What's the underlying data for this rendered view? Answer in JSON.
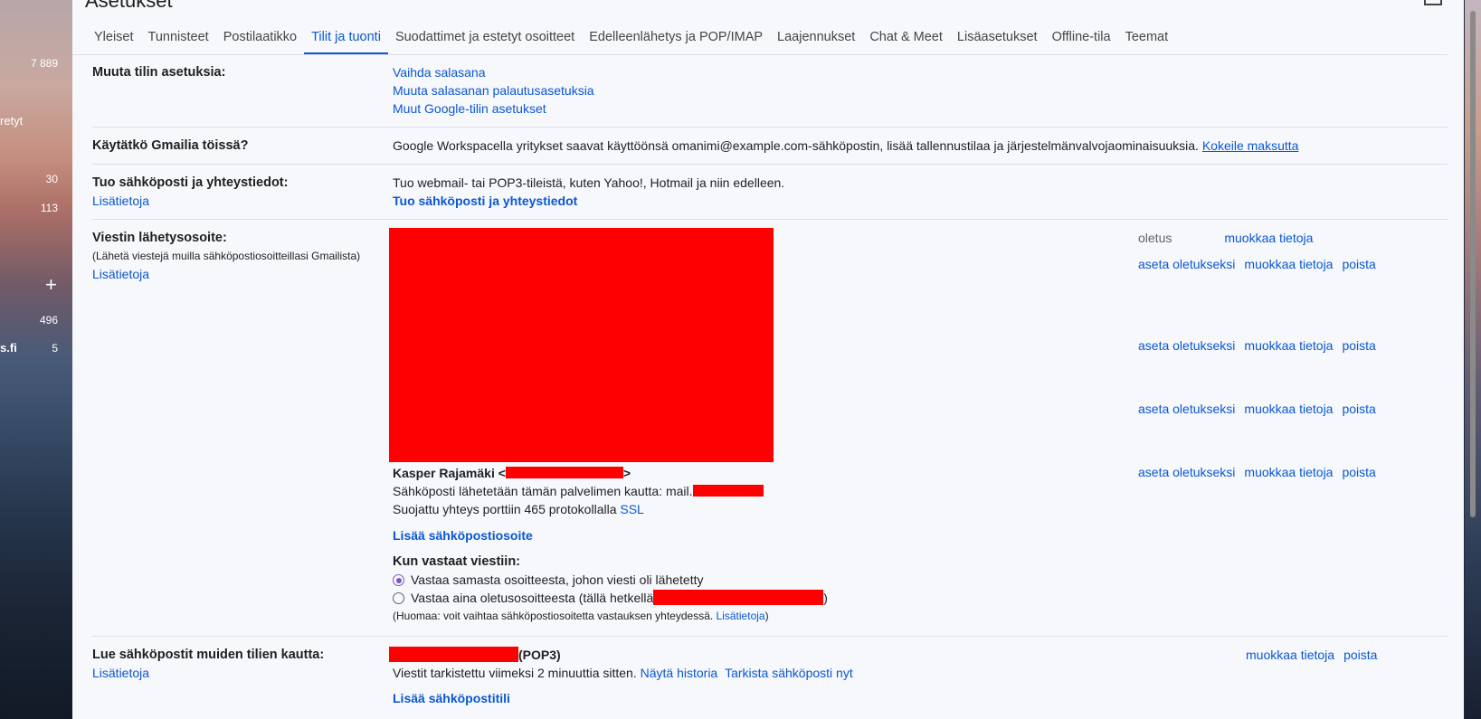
{
  "left_nav": {
    "count1": "7 889",
    "label1": "retyt",
    "count2": "30",
    "count3": "113",
    "plus": "+",
    "count4": "496",
    "label2": "s.fi",
    "count5": "5"
  },
  "page_title": "Asetukset",
  "tabs": [
    "Yleiset",
    "Tunnisteet",
    "Postilaatikko",
    "Tilit ja tuonti",
    "Suodattimet ja estetyt osoitteet",
    "Edelleenlähetys ja POP/IMAP",
    "Laajennukset",
    "Chat & Meet",
    "Lisäasetukset",
    "Offline-tila",
    "Teemat"
  ],
  "active_tab": "Tilit ja tuonti",
  "change_account": {
    "label": "Muuta tilin asetuksia:",
    "links": [
      "Vaihda salasana",
      "Muuta salasanan palautusasetuksia",
      "Muut Google-tilin asetukset"
    ]
  },
  "work": {
    "label": "Käytätkö Gmailia töissä?",
    "text": "Google Workspacella yritykset saavat käyttöönsä omanimi@example.com-sähköpostin, lisää tallennustilaa ja järjestelmänvalvojaominaisuuksia.",
    "link": "Kokeile maksutta"
  },
  "import": {
    "label": "Tuo sähköposti ja yhteystiedot:",
    "learn_more": "Lisätietoja",
    "text": "Tuo webmail- tai POP3-tileistä, kuten Yahoo!, Hotmail ja niin edelleen.",
    "action": "Tuo sähköposti ja yhteystiedot"
  },
  "send_as": {
    "label": "Viestin lähetysosoite:",
    "sub": "(Lähetä viestejä muilla sähköpostiosoitteillasi Gmailista)",
    "learn_more": "Lisätietoja",
    "default_label": "oletus",
    "set_default": "aseta oletukseksi",
    "edit": "muokkaa tietoja",
    "delete": "poista",
    "last_name": "Kasper Rajamäki <",
    "last_name_end": ">",
    "smtp_text": "Sähköposti lähetetään tämän palvelimen kautta: mail.",
    "secure_text": "Suojattu yhteys porttiin 465 protokollalla",
    "ssl": "SSL",
    "add_address": "Lisää sähköpostiosoite",
    "reply_label": "Kun vastaat viestiin:",
    "reply_option1": "Vastaa samasta osoitteesta, johon viesti oli lähetetty",
    "reply_option2": "Vastaa aina oletusosoitteesta (tällä hetkellä",
    "reply_option2_end": ")",
    "note": "(Huomaa: voit vaihtaa sähköpostiosoitetta vastauksen yhteydessä.",
    "note_link": "Lisätietoja",
    "note_end": ")"
  },
  "check_mail": {
    "label": "Lue sähköpostit muiden tilien kautta:",
    "learn_more": "Lisätietoja",
    "protocol": "(POP3)",
    "status": "Viestit tarkistettu viimeksi 2 minuuttia sitten.",
    "history": "Näytä historia",
    "check_now": "Tarkista sähköposti nyt",
    "add_account": "Lisää sähköpostitili",
    "edit": "muokkaa tietoja",
    "delete": "poista"
  },
  "colors": {
    "link": "#0b57d0",
    "redaction": "#ff0000",
    "active_tab": "#0b57d0",
    "radio_on": "#7e57c2"
  }
}
